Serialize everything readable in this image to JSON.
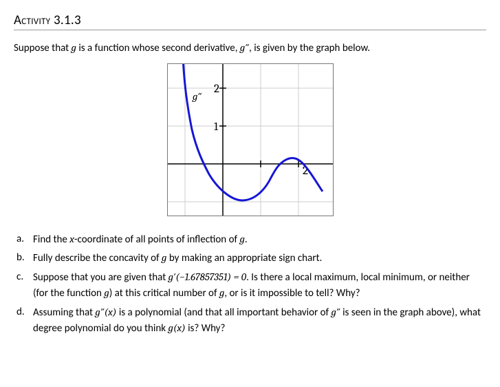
{
  "header": {
    "label": "Activity",
    "number": "3.1.3"
  },
  "intro": {
    "pre": "Suppose that ",
    "fn": "g",
    "mid": " is a function whose second derivative, ",
    "fn2": "g″",
    "post": ", is given by the graph below."
  },
  "chart_data": {
    "type": "line",
    "title": "",
    "series_label": "g″",
    "xlabel": "",
    "ylabel": "",
    "xlim": [
      -1.3,
      2.7
    ],
    "ylim": [
      -1.3,
      2.7
    ],
    "xticks": [
      1,
      2
    ],
    "yticks": [
      1,
      2
    ],
    "tick_labels": {
      "x": {
        "1": "",
        "2": "2"
      },
      "y": {
        "1": "1",
        "2": "2"
      }
    },
    "grid": true,
    "curve_points": [
      {
        "x": -1.05,
        "y": 2.7
      },
      {
        "x": -0.9,
        "y": 1.6
      },
      {
        "x": -0.7,
        "y": 0.65
      },
      {
        "x": -0.5,
        "y": 0.0
      },
      {
        "x": -0.2,
        "y": -0.55
      },
      {
        "x": 0.1,
        "y": -0.85
      },
      {
        "x": 0.5,
        "y": -0.95
      },
      {
        "x": 0.9,
        "y": -0.7
      },
      {
        "x": 1.2,
        "y": -0.3
      },
      {
        "x": 1.5,
        "y": 0.0
      },
      {
        "x": 1.8,
        "y": 0.15
      },
      {
        "x": 2.0,
        "y": 0.1
      },
      {
        "x": 2.3,
        "y": -0.15
      },
      {
        "x": 2.6,
        "y": -0.6
      }
    ]
  },
  "questions": {
    "a": "Find the x-coordinate of all points of inflection of g.",
    "b": "Fully describe the concavity of g by making an appropriate sign chart.",
    "c": "Suppose that you are given that g′(−1.67857351) = 0. Is there a local maximum, local minimum, or neither (for the function g) at this critical number of g, or is it impossible to tell? Why?",
    "d": "Assuming that g″(x) is a polynomial (and that all important behavior of g″ is seen in the graph above), what degree polynomial do you think g(x) is? Why?"
  },
  "formatted": {
    "a_pre": "Find the ",
    "a_xvar": "x",
    "a_post1": "-coordinate of all points of inflection of ",
    "a_g": "g",
    "a_end": ".",
    "b_pre": "Fully describe the concavity of ",
    "b_g": "g",
    "b_post": " by making an appropriate sign chart.",
    "c_pre": "Suppose that you are given that ",
    "c_expr": "g′(−1.67857351) = 0",
    "c_mid": ". Is there a local maximum, local minimum, or neither (for the function ",
    "c_g": "g",
    "c_mid2": ") at this critical number of ",
    "c_g2": "g",
    "c_end": ", or is it impossible to tell? Why?",
    "d_pre": "Assuming that ",
    "d_expr": "g″(x)",
    "d_mid": " is a polynomial (and that all important behavior of ",
    "d_expr2": "g″",
    "d_mid2": " is seen in the graph above), what degree polynomial do you think ",
    "d_expr3": "g(x)",
    "d_end": " is? Why?"
  }
}
